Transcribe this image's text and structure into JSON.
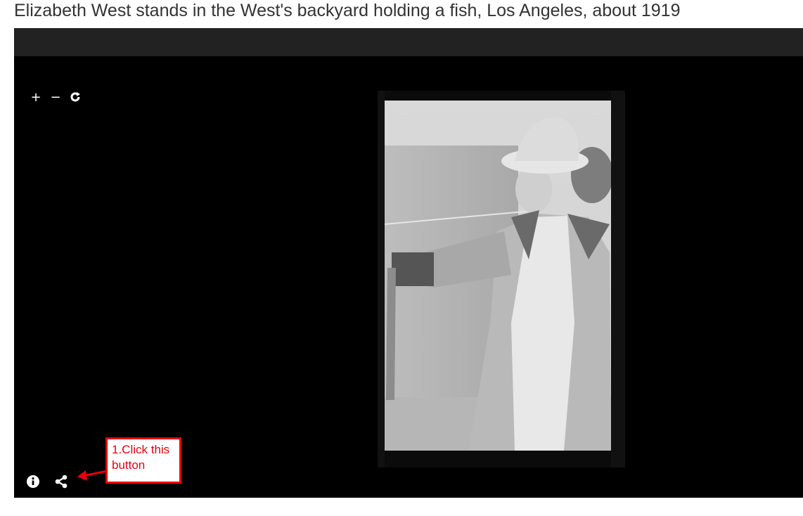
{
  "page": {
    "title": "Elizabeth West stands in the West's backyard holding a fish, Los Angeles, about 1919"
  },
  "viewer": {
    "zoom_in_icon": "+",
    "zoom_out_icon": "−",
    "reset_icon": "rotate-icon",
    "info_icon": "info-icon",
    "share_icon": "share-icon"
  },
  "annotation": {
    "text": "1.Click this button",
    "color": "#e8000b"
  }
}
